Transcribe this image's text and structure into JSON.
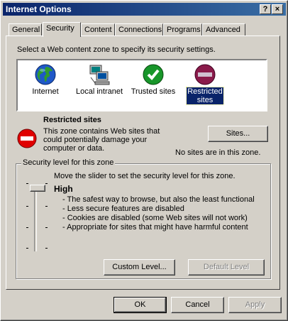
{
  "window": {
    "title": "Internet Options",
    "help_glyph": "?",
    "close_glyph": "×"
  },
  "tabs": [
    {
      "label": "General"
    },
    {
      "label": "Security",
      "active": true
    },
    {
      "label": "Content"
    },
    {
      "label": "Connections"
    },
    {
      "label": "Programs"
    },
    {
      "label": "Advanced"
    }
  ],
  "security": {
    "instruction": "Select a Web content zone to specify its security settings.",
    "zones": [
      {
        "label": "Internet",
        "icon": "globe-icon"
      },
      {
        "label": "Local intranet",
        "icon": "network-computer-icon"
      },
      {
        "label": "Trusted sites",
        "icon": "green-check-icon"
      },
      {
        "label": "Restricted sites",
        "icon": "no-entry-icon",
        "selected": true
      }
    ],
    "selected_zone": {
      "title": "Restricted sites",
      "description": "This zone contains Web sites that could potentially damage your computer or data.",
      "sites_button": "Sites...",
      "sites_status": "No sites are in this zone."
    },
    "level_group": {
      "label": "Security level for this zone",
      "instruction": "Move the slider to set the security level for this zone.",
      "level_name": "High",
      "level_index": 3,
      "level_count": 4,
      "bullets": [
        "- The safest way to browse, but also the least functional",
        "- Less secure features are disabled",
        "- Cookies are disabled (some Web sites will not work)",
        "- Appropriate for sites that might have harmful content"
      ],
      "custom_button": "Custom Level...",
      "default_button": "Default Level"
    }
  },
  "footer": {
    "ok": "OK",
    "cancel": "Cancel",
    "apply": "Apply"
  },
  "colors": {
    "title_start": "#0a246a",
    "title_end": "#3a6ea5",
    "face": "#d4d0c8",
    "selection": "#0a246a"
  }
}
